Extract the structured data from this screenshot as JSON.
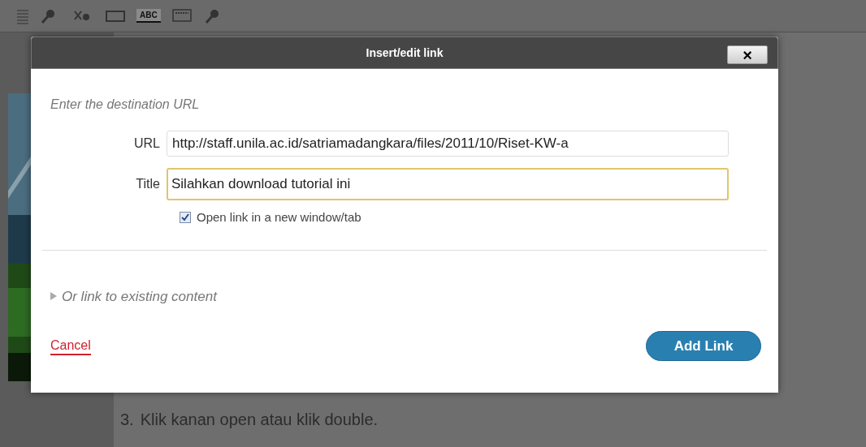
{
  "toolbar": {
    "items": [
      {
        "kind": "icon"
      },
      {
        "kind": "icon"
      },
      {
        "kind": "icon"
      },
      {
        "kind": "text",
        "label": "ABC"
      },
      {
        "kind": "icon"
      },
      {
        "kind": "icon"
      }
    ]
  },
  "editor": {
    "list_items": [
      {
        "number": "3.",
        "text": "Klik kanan open atau klik double."
      }
    ]
  },
  "dialog": {
    "title": "Insert/edit link",
    "close": "×",
    "intro": "Enter the destination URL",
    "fields": [
      {
        "label": "URL",
        "value": "http://staff.unila.ac.id/satriamadangkara/files/2011/10/Riset-KW-a",
        "focused": false
      },
      {
        "label": "Title",
        "value": "Silahkan download tutorial ini",
        "focused": true
      }
    ],
    "new_window": {
      "label": "Open link in a new window/tab",
      "checked": true
    },
    "existing_content": {
      "label": "Or link to existing content",
      "expanded": false
    },
    "cancel": "Cancel",
    "submit": "Add Link"
  }
}
